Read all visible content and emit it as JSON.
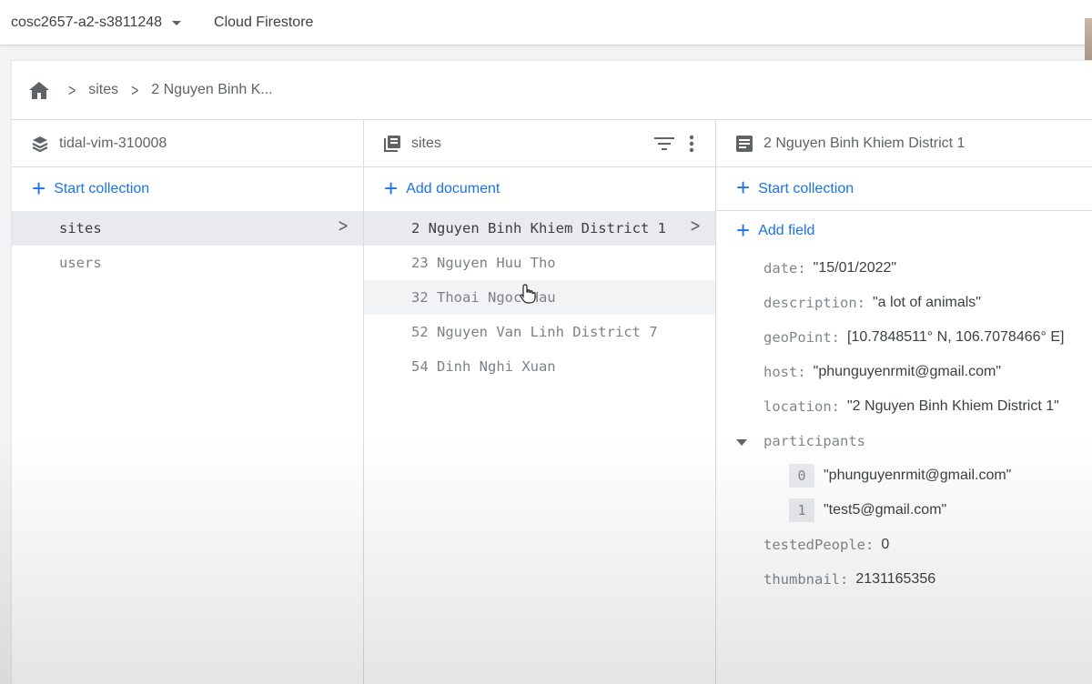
{
  "topbar": {
    "project_name": "cosc2657-a2-s3811248",
    "product_name": "Cloud Firestore"
  },
  "breadcrumb": {
    "home_icon": "home-icon",
    "items": [
      "sites",
      "2 Nguyen Binh K..."
    ]
  },
  "columns": {
    "root": {
      "title": "tidal-vim-310008",
      "icon": "database-icon",
      "action_label": "Start collection",
      "items": [
        "sites",
        "users"
      ],
      "selected_index": 0
    },
    "collection": {
      "title": "sites",
      "icon": "collection-icon",
      "action_label": "Add document",
      "items": [
        "2 Nguyen Binh Khiem District 1",
        "23 Nguyen Huu Tho",
        "32 Thoai Ngoc Hau",
        "52 Nguyen Van Linh District 7",
        "54 Dinh Nghi Xuan"
      ],
      "selected_index": 0,
      "hover_index": 2
    },
    "document": {
      "title": "2 Nguyen Binh Khiem District 1",
      "icon": "document-icon",
      "start_collection_label": "Start collection",
      "add_field_label": "Add field",
      "fields": [
        {
          "key": "date:",
          "value": "\"15/01/2022\""
        },
        {
          "key": "description:",
          "value": "\"a lot of animals\""
        },
        {
          "key": "geoPoint:",
          "value": "[10.7848511° N, 106.7078466° E]"
        },
        {
          "key": "host:",
          "value": "\"phunguyenrmit@gmail.com\""
        },
        {
          "key": "location:",
          "value": "\"2 Nguyen Binh Khiem District 1\""
        }
      ],
      "participants": {
        "key": "participants",
        "items": [
          {
            "index": "0",
            "value": "\"phunguyenrmit@gmail.com\""
          },
          {
            "index": "1",
            "value": "\"test5@gmail.com\""
          }
        ]
      },
      "fields_after": [
        {
          "key": "testedPeople:",
          "value": "0"
        },
        {
          "key": "thumbnail:",
          "value": "2131165356"
        }
      ]
    }
  },
  "colors": {
    "accent": "#1a73e8",
    "selected_row": "#e8eaed",
    "text_muted": "#80868b"
  }
}
